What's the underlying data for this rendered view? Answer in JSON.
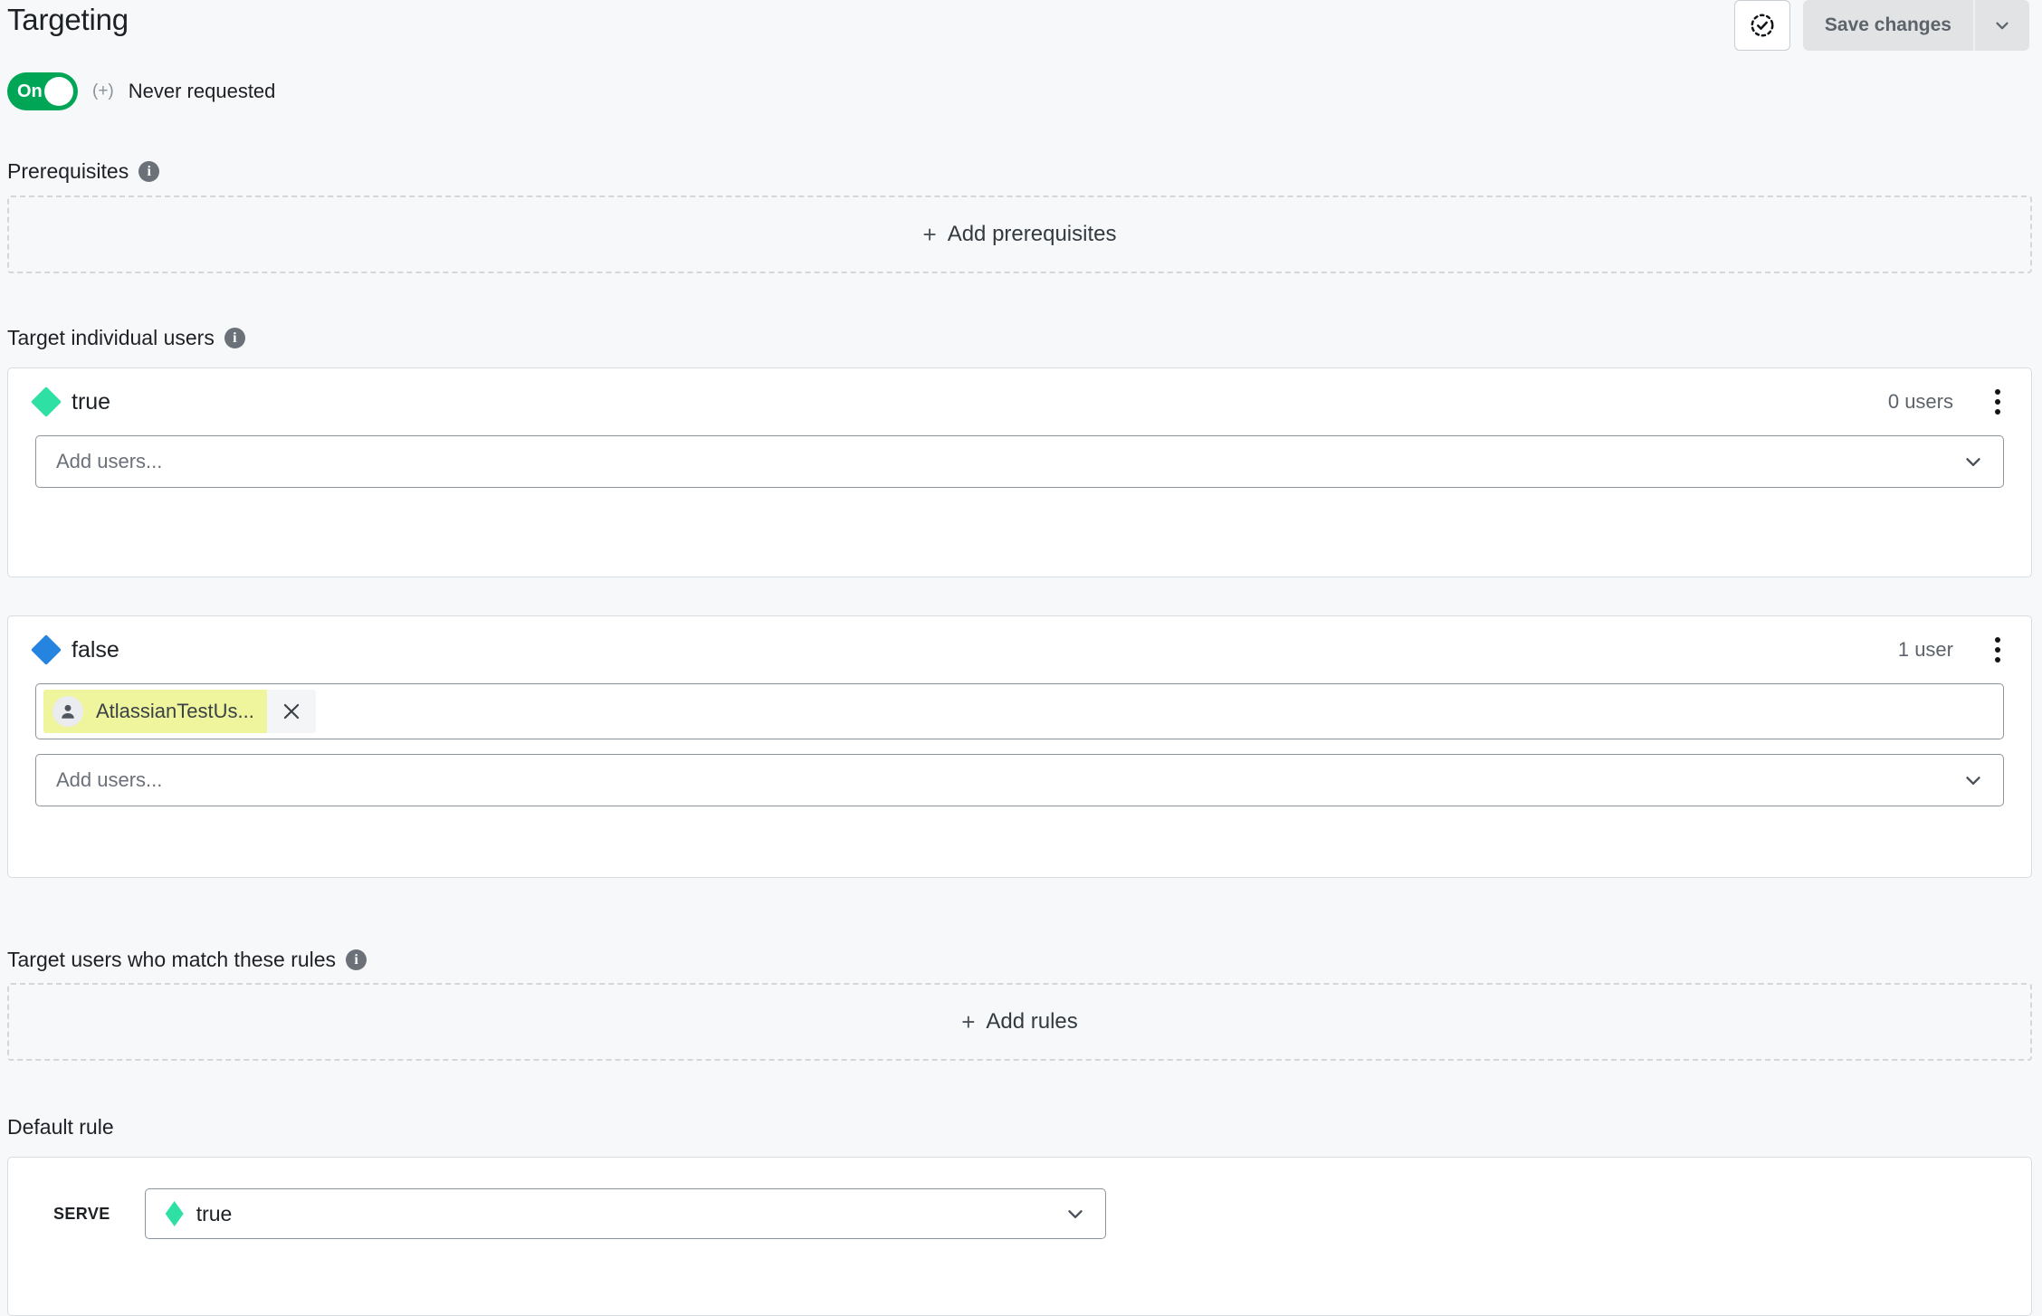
{
  "header": {
    "title": "Targeting",
    "check_icon": "check-circle-dashed-icon",
    "save_label": "Save changes",
    "save_caret_icon": "chevron-down-icon"
  },
  "status": {
    "toggle_label": "On",
    "toggle_on": true,
    "toggle_color": "#00a656",
    "plus_marker": "(+)",
    "request_status": "Never requested"
  },
  "prerequisites": {
    "label": "Prerequisites",
    "info_icon": "info-icon",
    "add_label": "Add prerequisites",
    "add_plus": "+"
  },
  "target_individual_users": {
    "label": "Target individual users",
    "info_icon": "info-icon",
    "variations": [
      {
        "name": "true",
        "color": "#2ee0a4",
        "user_count": "0 users",
        "kebab_icon": "more-vertical-icon",
        "chips": [],
        "input_placeholder": "Add users...",
        "chevron_icon": "chevron-down-icon"
      },
      {
        "name": "false",
        "color": "#2584e0",
        "user_count": "1 user",
        "kebab_icon": "more-vertical-icon",
        "chips": [
          {
            "name": "AtlassianTestUs...",
            "avatar_icon": "person-icon",
            "remove_icon": "close-icon",
            "highlight_color": "#eff59c"
          }
        ],
        "input_placeholder": "Add users...",
        "chevron_icon": "chevron-down-icon"
      }
    ]
  },
  "target_rules": {
    "label": "Target users who match these rules",
    "info_icon": "info-icon",
    "add_label": "Add rules",
    "add_plus": "+"
  },
  "default_rule": {
    "label": "Default rule",
    "serve_label": "SERVE",
    "serve_value": "true",
    "serve_color": "#2ee0a4",
    "chevron_icon": "chevron-down-icon"
  }
}
